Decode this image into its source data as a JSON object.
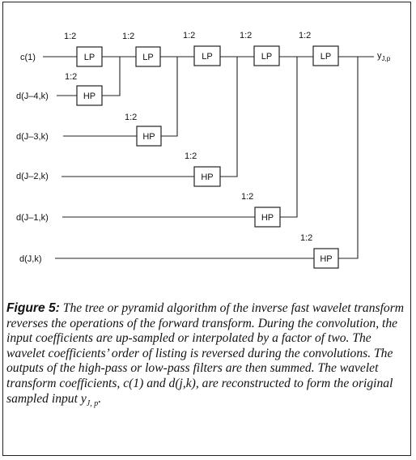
{
  "inputs": [
    "c(1)",
    "d(J–4,k)",
    "d(J–3,k)",
    "d(J–2,k)",
    "d(J–1,k)",
    "d(J,k)"
  ],
  "ratio": "1:2",
  "lp_label": "LP",
  "hp_label": "HP",
  "output": {
    "main": "y",
    "sub": "J,p"
  },
  "caption": {
    "label": "Figure 5:",
    "text": "The tree or pyramid algorithm of the inverse fast wavelet transform reverses the operations of the forward transform. During the convolution, the input coefficients are up-sampled or interpolated by a factor of two. The wavelet coefficients’ order of listing is reversed during the convolutions. The outputs of the high-pass or low-pass filters are then summed. The wavelet transform coefficients, c(1) and d(j,k), are reconstructed to form the original sampled input y",
    "text_sub": "J, p",
    "text_end": "."
  }
}
